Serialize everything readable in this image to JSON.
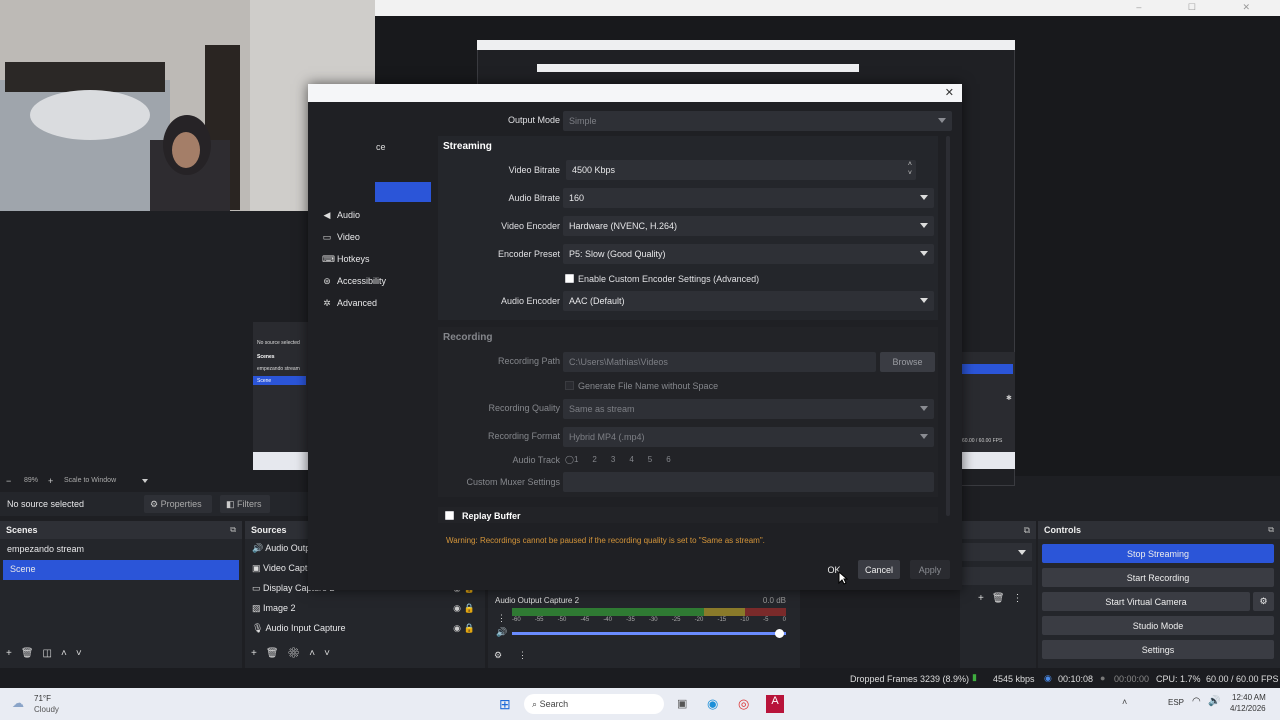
{
  "window": {
    "controls": [
      "–",
      "☐",
      "✕"
    ]
  },
  "preview": {
    "zoom": "89%",
    "scale_mode": "Scale to Window",
    "thumb_header": "No source selected",
    "thumb_scenes": "Scenes",
    "thumb_scene1": "empezando stream",
    "thumb_scene2": "Scene",
    "thumb_fps": "60.00 / 60.00 FPS"
  },
  "source_bar": {
    "status": "No source selected",
    "properties": "Properties",
    "filters": "Filters"
  },
  "scenes": {
    "title": "Scenes",
    "items": [
      "empezando stream",
      "Scene"
    ]
  },
  "sources": {
    "title": "Sources",
    "items": [
      "Audio Outp",
      "Video Capt",
      "Display Capture 2",
      "Image 2",
      "Audio Input Capture"
    ]
  },
  "mixer": {
    "channel": "Audio Output Capture 2",
    "db": "0.0 dB",
    "scale": [
      "-60",
      "-55",
      "-50",
      "-45",
      "-40",
      "-35",
      "-30",
      "-25",
      "-20",
      "-15",
      "-10",
      "-5",
      "0"
    ]
  },
  "controls": {
    "title": "Controls",
    "buttons": [
      "Stop Streaming",
      "Start Recording",
      "Start Virtual Camera",
      "Studio Mode",
      "Settings"
    ]
  },
  "status": {
    "dropped": "Dropped Frames 3239 (8.9%)",
    "bitrate": "4545 kbps",
    "stream_time": "00:10:08",
    "rec_time": "00:00:00",
    "cpu": "CPU: 1.7%",
    "fps": "60.00 / 60.00 FPS"
  },
  "taskbar": {
    "temp": "71°F",
    "weather": "Cloudy",
    "search": "Search",
    "lang": "ESP",
    "time": "12:40 AM",
    "date": "4/12/2026"
  },
  "dialog": {
    "nav_partial": "ce",
    "nav": [
      {
        "icon": "🔊",
        "label": "Audio"
      },
      {
        "icon": "▭",
        "label": "Video"
      },
      {
        "icon": "⌨",
        "label": "Hotkeys"
      },
      {
        "icon": "➊",
        "label": "Accessibility"
      },
      {
        "icon": "✲",
        "label": "Advanced"
      }
    ],
    "output_mode_label": "Output Mode",
    "output_mode": "Simple",
    "streaming_title": "Streaming",
    "video_bitrate_label": "Video Bitrate",
    "video_bitrate": "4500 Kbps",
    "audio_bitrate_label": "Audio Bitrate",
    "audio_bitrate": "160",
    "video_encoder_label": "Video Encoder",
    "video_encoder": "Hardware (NVENC, H.264)",
    "encoder_preset_label": "Encoder Preset",
    "encoder_preset": "P5: Slow (Good Quality)",
    "custom_encoder": "Enable Custom Encoder Settings (Advanced)",
    "audio_encoder_label": "Audio Encoder",
    "audio_encoder": "AAC (Default)",
    "recording_title": "Recording",
    "recording_path_label": "Recording Path",
    "recording_path": "C:\\Users\\Mathias\\Videos",
    "browse": "Browse",
    "gen_filename": "Generate File Name without Space",
    "rec_quality_label": "Recording Quality",
    "rec_quality": "Same as stream",
    "rec_format_label": "Recording Format",
    "rec_format": "Hybrid MP4 (.mp4)",
    "audio_track_label": "Audio Track",
    "tracks": [
      "1",
      "2",
      "3",
      "4",
      "5",
      "6"
    ],
    "muxer_label": "Custom Muxer Settings",
    "replay_buffer": "Replay Buffer",
    "warning": "Warning: Recordings cannot be paused if the recording quality is set to \"Same as stream\".",
    "ok": "OK",
    "cancel": "Cancel",
    "apply": "Apply"
  }
}
